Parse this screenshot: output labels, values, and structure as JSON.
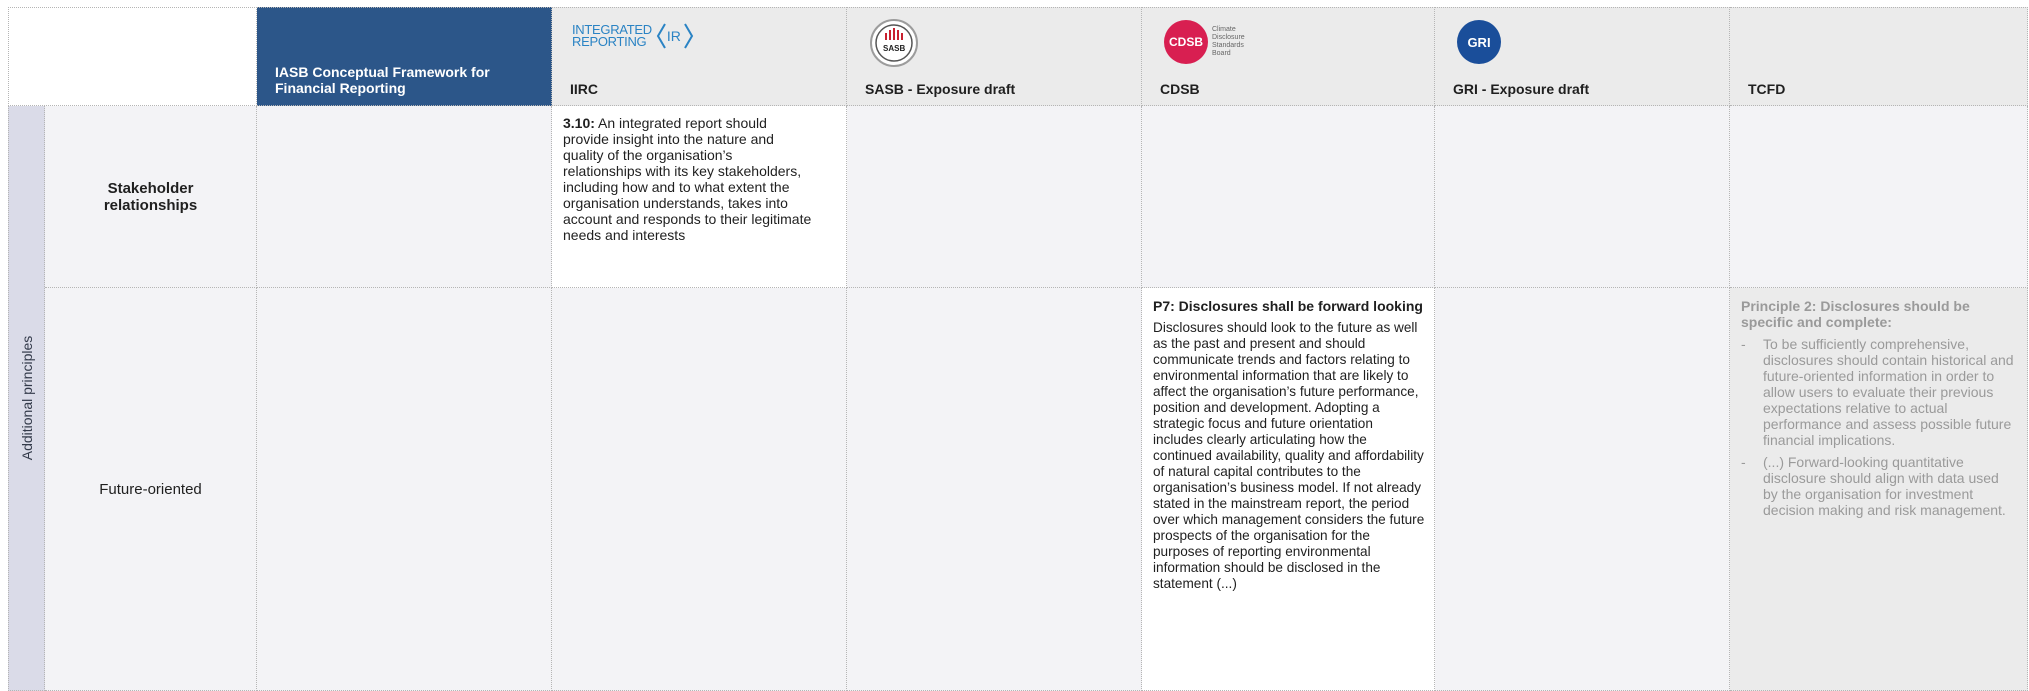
{
  "header": {
    "iasb": "IASB Conceptual Framework for Financial Reporting",
    "iirc": "IIRC",
    "sasb": "SASB - Exposure draft",
    "cdsb": "CDSB",
    "gri": "GRI - Exposure draft",
    "tcfd": "TCFD"
  },
  "logos": {
    "iirc_line1": "INTEGRATED",
    "iirc_line2": "REPORTING",
    "iirc_mark": "IR",
    "sasb": "SASB",
    "cdsb_mark": "CDSB",
    "cdsb_words": [
      "Climate",
      "Disclosure",
      "Standards",
      "Board"
    ],
    "gri": "GRI"
  },
  "sidebar": {
    "label": "Additional principles"
  },
  "rows": [
    {
      "label": "Stakeholder relationships",
      "iirc": {
        "ref": "3.10:",
        "text": " An integrated report should provide insight into the nature and quality of the organisation’s relationships with its key stakeholders, including how and to what extent the organisation understands, takes into account and responds to their legitimate needs and interests"
      }
    },
    {
      "label": "Future-oriented",
      "cdsb": {
        "title": "P7: Disclosures shall be forward looking",
        "text": "Disclosures should look to the future as well as the past and present and should communicate trends and factors relating to environmental information that are likely to affect the organisation’s future performance, position and development. Adopting a strategic focus and future orientation includes clearly articulating how the continued availability, quality and affordability of natural capital contributes to the organisation’s business model. If not already stated in the mainstream report, the period over which management considers the future prospects of the organisation for the purposes of reporting environmental information should be disclosed in the statement (...)"
      },
      "tcfd": {
        "title": "Principle 2: Disclosures should be specific and complete:",
        "bullets": [
          "To be sufficiently comprehensive, disclosures should contain historical and future-oriented information in order to allow users to evaluate their previous expectations relative to actual performance and assess possible future financial implications.",
          "(...) Forward-looking quantitative disclosure should align with data used by the organisation for investment decision making and risk management."
        ]
      }
    }
  ]
}
